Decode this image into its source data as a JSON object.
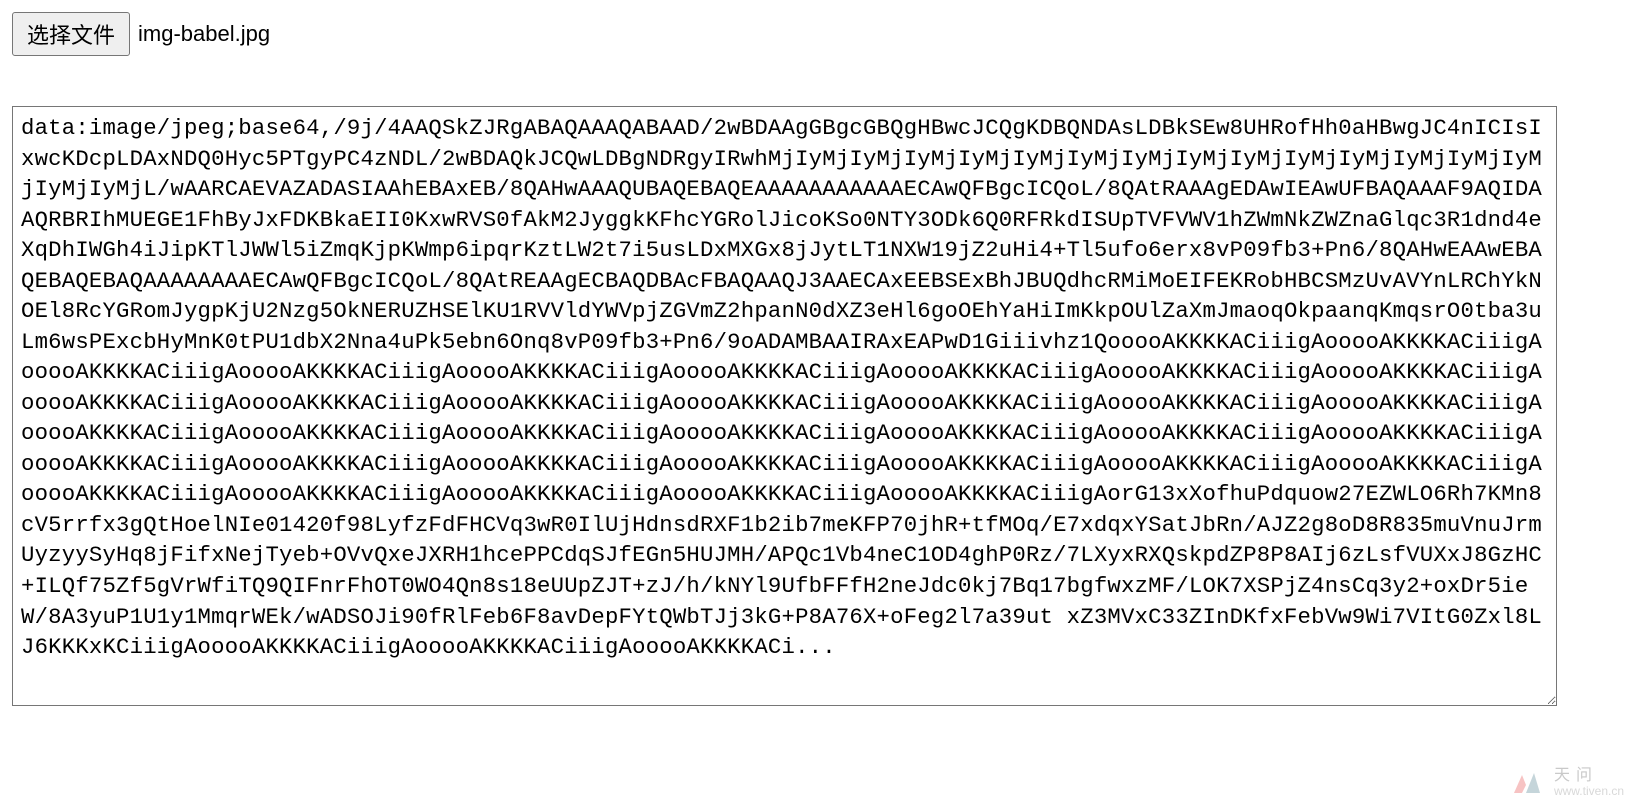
{
  "fileInput": {
    "buttonLabel": "选择文件",
    "selectedFile": "img-babel.jpg"
  },
  "output": {
    "value": "data:image/jpeg;base64,/9j/4AAQSkZJRgABAQAAAQABAAD/2wBDAAgGBgcGBQgHBwcJCQgKDBQNDAsLDBkSEw8UHRofHh0aHBwgJC4nICIsIxwcKDcpLDAxNDQ0Hyc5PTgyPC4zNDL/2wBDAQkJCQwLDBgNDRgyIRwhMjIyMjIyMjIyMjIyMjIyMjIyMjIyMjIyMjIyMjIyMjIyMjIyMjIyMjIyMjIyMjIyMjL/wAARCAEVAZADASIAAhEBAxEB/8QAHwAAAQUBAQEBAQEAAAAAAAAAAAECAwQFBgcICQoL/8QAtRAAAgEDAwIEAwUFBAQAAAF9AQIDAAQRBRIhMUEGE1FhByJxFDKBkaEII0KxwRVS0fAkM2JyggkKFhcYGRolJicoKSo0NTY3ODk6Q0RFRkdISUpTVFVWV1hZWmNkZWZnaGlqc3R1dnd4eXqDhIWGh4iJipKTlJWWl5iZmqKjpKWmp6ipqrKztLW2t7i5usLDxMXGx8jJytLT1NXW19jZ2uHi4+Tl5ufo6erx8vP09fb3+Pn6/8QAHwEAAwEBAQEBAQEBAQAAAAAAAAECAwQFBgcICQoL/8QAtREAAgECBAQDBAcFBAQAAQJ3AAECAxEEBSExBhJBUQdhcRMiMoEIFEKRobHBCSMzUvAVYnLRChYkNOEl8RcYGRomJygpKjU2Nzg5OkNERUZHSElKU1RVVldYWVpjZGVmZ2hpanN0dXZ3eHl6goOEhYaHiImKkpOUlZaXmJmaoqOkpaanqKmqsrO0tba3uLm6wsPExcbHyMnK0tPU1dbX2Nna4uPk5ebn6Onq8vP09fb3+Pn6/9oADAMBAAIRAxEAPwD1Giiivhz1QooooAKKKKACiiigAooooAKKKKACiiigAooooAKKKKACiiigAooooAKKKKACiiigAooooAKKKKACiiigAooooAKKKKACiiigAooooAKKKKACiiigAooooAKKKKACiiigAooooAKKKKACiiigAooooAKKKKACiiigAooooAKKKKACiiigAooooAKKKKACiiigAooooAKKKKACiiigAooooAKKKKACiiigAooooAKKKKACiiigAooooAKKKKACiiigAooooAKKKKACiiigAooooAKKKKACiiigAooooAKKKKACiiigAooooAKKKKACiiigAooooAKKKKACiiigAooooAKKKKACiiigAooooAKKKKACiiigAooooAKKKKACiiigAooooAKKKKACiiigAooooAKKKKACiiigAooooAKKKKACiiigAooooAKKKKACiiigAooooAKKKKACiiigAooooAKKKKACiiigAooooAKKKKACiiigAooooAKKKKACiiigAooooAKKKKACiiigAooooAKKKKACiiigAooooAKKKKACiiigAorG13xXofhuPdquow27EZWLO6Rh7KMn8cV5rrfx3gQtHoelNIe01420f98LyfzFdFHCVq3wR0IlUjHdnsdRXF1b2ib7meKFP70jhR+tfMOq/E7xdqxYSatJbRn/AJZ2g8oD8R835muVnuJrmUyzyySyHq8jFifxNejTyeb+OVvQxeJXRH1hcePPCdqSJfEGn5HUJMH/APQc1Vb4neC1OD4ghP0Rz/7LXyxRXQskpdZP8P8AIj6zLsfVUXxJ8GzHC+ILQf75Zf5gVrWfiTQ9QIFnrFhOT0WO4Qn8s18eUUpZJT+zJ/h/kNYl9UfbFFfH2neJdc0kj7Bq17bgfwxzMF/LOK7XSPjZ4nsCq3y2+oxDr5ieW/8A3yuP1U1y1MmqrWEk/wADSOJi90fRlFeb6F8avDepFYtQWbTJj3kG+P8A76X+oFeg2l7a39ut xZ3MVxC33ZInDKfxFebVw9Wi7VItG0Zxl8LJ6KKKxKCiiigAooooAKKKKACiiigAooooAKKKKACiiigAooooAKKKKACi..."
  },
  "watermark": {
    "title": "天问",
    "url": "www.tiven.cn"
  }
}
